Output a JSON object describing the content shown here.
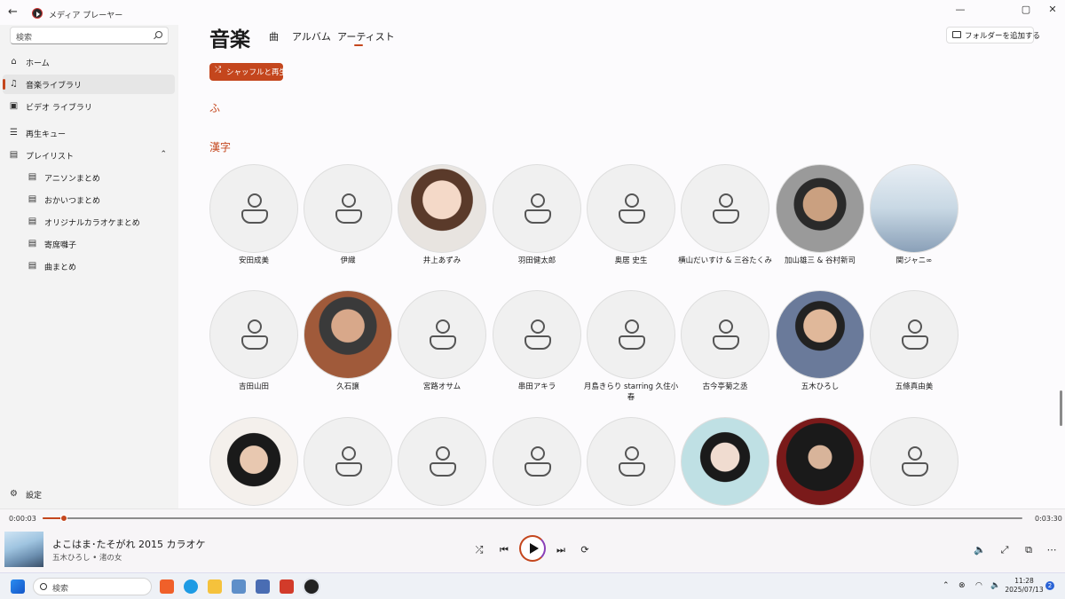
{
  "window": {
    "title": "メディア プレーヤー",
    "back": "←",
    "minimize": "—",
    "maximize": "▢",
    "close": "✕"
  },
  "sidebar": {
    "search_placeholder": "検索",
    "items": [
      {
        "label": "ホーム",
        "icon": "home-icon",
        "glyph": "⌂"
      },
      {
        "label": "音楽ライブラリ",
        "icon": "music-note-icon",
        "glyph": "♫",
        "active": true
      },
      {
        "label": "ビデオ ライブラリ",
        "icon": "video-icon",
        "glyph": "▣"
      },
      {
        "label": "再生キュー",
        "icon": "queue-icon",
        "glyph": "☰"
      },
      {
        "label": "プレイリスト",
        "icon": "playlist-icon",
        "glyph": "▤",
        "expanded": true
      }
    ],
    "playlists": [
      "アニソンまとめ",
      "おかいつまとめ",
      "オリジナルカラオケまとめ",
      "寄席囃子",
      "曲まとめ"
    ],
    "settings": "設定"
  },
  "header": {
    "title": "音楽",
    "tabs": [
      "曲",
      "アルバム",
      "アーティスト"
    ],
    "active_tab": "アーティスト",
    "add_folder": "フォルダーを追加する",
    "shuffle": "シャッフルと再生"
  },
  "sections": {
    "fu": "ふ",
    "kanji": "漢字"
  },
  "artists": [
    {
      "name": "安田成美",
      "photo": false
    },
    {
      "name": "伊織",
      "photo": false
    },
    {
      "name": "井上あずみ",
      "photo": true
    },
    {
      "name": "羽田健太郎",
      "photo": false
    },
    {
      "name": "奥居 史生",
      "photo": false
    },
    {
      "name": "横山だいすけ & 三谷たくみ",
      "photo": false
    },
    {
      "name": "加山雄三 & 谷村新司",
      "photo": true
    },
    {
      "name": "関ジャニ∞",
      "photo": true
    },
    {
      "name": "吉田山田",
      "photo": false
    },
    {
      "name": "久石譲",
      "photo": true
    },
    {
      "name": "宮路オサム",
      "photo": false
    },
    {
      "name": "串田アキラ",
      "photo": false
    },
    {
      "name": "月島きらり starring 久住小春",
      "photo": false
    },
    {
      "name": "古今亭菊之丞",
      "photo": false
    },
    {
      "name": "五木ひろし",
      "photo": true
    },
    {
      "name": "五條真由美",
      "photo": false
    },
    {
      "name": "",
      "photo": true
    },
    {
      "name": "",
      "photo": false
    },
    {
      "name": "",
      "photo": false
    },
    {
      "name": "",
      "photo": false
    },
    {
      "name": "",
      "photo": false
    },
    {
      "name": "",
      "photo": true
    },
    {
      "name": "",
      "photo": true
    },
    {
      "name": "",
      "photo": false
    }
  ],
  "player": {
    "elapsed": "0:00:03",
    "duration": "0:03:30",
    "progress_fraction": 0.022,
    "song": "よこはま･たそがれ 2015 カラオケ",
    "artist_album": "五木ひろし • 渚の女"
  },
  "taskbar": {
    "search_placeholder": "検索",
    "time": "11:28",
    "date": "2025/07/13",
    "notifications": "2"
  },
  "colors": {
    "accent": "#c4461d",
    "sidebar_bg": "#f3f3f3"
  }
}
